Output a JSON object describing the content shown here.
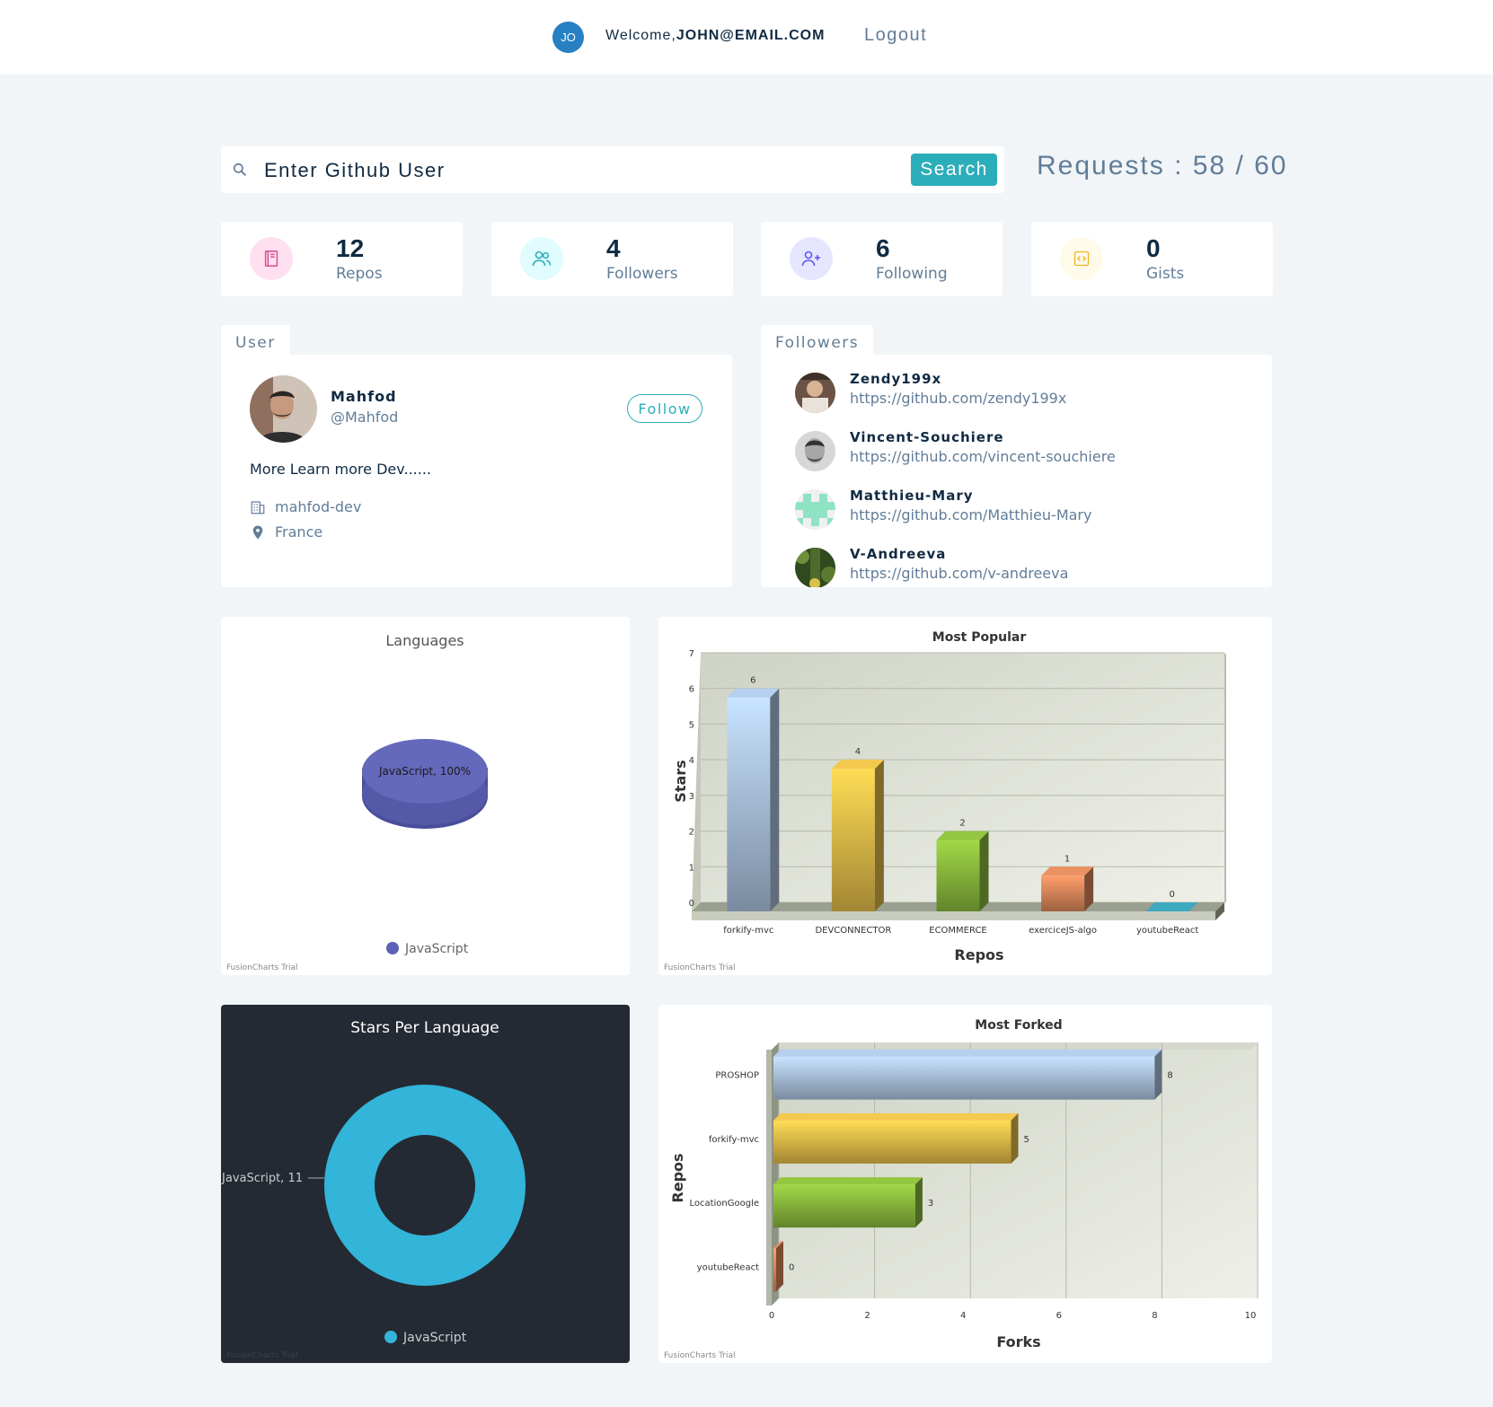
{
  "nav": {
    "avatar_initials": "JO",
    "welcome_prefix": "Welcome,",
    "welcome_user": "JOHN@EMAIL.COM",
    "logout_label": "Logout"
  },
  "search": {
    "placeholder": "Enter Github User",
    "button_label": "Search",
    "requests_text": "Requests : 58 / 60"
  },
  "stats": [
    {
      "value": "12",
      "label": "Repos",
      "icon": "book-icon",
      "color": "#da4a91"
    },
    {
      "value": "4",
      "label": "Followers",
      "icon": "users-icon",
      "color": "#2caeba"
    },
    {
      "value": "6",
      "label": "Following",
      "icon": "user-plus-icon",
      "color": "#5d55fa"
    },
    {
      "value": "0",
      "label": "Gists",
      "icon": "code-icon",
      "color": "#f0b429"
    }
  ],
  "user": {
    "tab_label": "User",
    "name": "Mahfod",
    "login": "@Mahfod",
    "follow_label": "Follow",
    "bio": "More Learn more Dev......",
    "company": "mahfod-dev",
    "location": "France"
  },
  "followers": {
    "tab_label": "Followers",
    "items": [
      {
        "name": "Zendy199x",
        "url": "https://github.com/zendy199x"
      },
      {
        "name": "Vincent-Souchiere",
        "url": "https://github.com/vincent-souchiere"
      },
      {
        "name": "Matthieu-Mary",
        "url": "https://github.com/Matthieu-Mary"
      },
      {
        "name": "V-Andreeva",
        "url": "https://github.com/v-andreeva"
      }
    ]
  },
  "chart_data": [
    {
      "type": "pie",
      "title": "Languages",
      "categories": [
        "JavaScript"
      ],
      "values": [
        100
      ],
      "slice_label": "JavaScript, 100%",
      "legend": [
        "JavaScript"
      ],
      "colors": [
        "#5d62b5"
      ],
      "watermark": "FusionCharts Trial"
    },
    {
      "type": "bar",
      "title": "Most Popular",
      "xlabel": "Repos",
      "ylabel": "Stars",
      "categories": [
        "forkify-mvc",
        "DEVCONNECTOR",
        "ECOMMERCE",
        "exerciceJS-algo",
        "youtubeReact"
      ],
      "values": [
        6,
        4,
        2,
        1,
        0
      ],
      "ylim": [
        0,
        7
      ],
      "yticks": [
        0,
        1,
        2,
        3,
        4,
        5,
        6,
        7
      ],
      "colors": [
        "#aec6e4",
        "#e8c04a",
        "#8cbd3e",
        "#e08a5d",
        "#3aa1b5"
      ],
      "watermark": "FusionCharts Trial"
    },
    {
      "type": "pie",
      "title": "Stars Per Language",
      "categories": [
        "JavaScript"
      ],
      "values": [
        11
      ],
      "slice_label": "JavaScript, 11",
      "legend": [
        "JavaScript"
      ],
      "colors": [
        "#33b4d9"
      ],
      "background": "#242a33",
      "watermark": "FusionCharts Trial"
    },
    {
      "type": "bar",
      "orientation": "horizontal",
      "title": "Most Forked",
      "xlabel": "Forks",
      "ylabel": "Repos",
      "categories": [
        "PROSHOP",
        "forkify-mvc",
        "LocationGoogle",
        "youtubeReact"
      ],
      "values": [
        8,
        5,
        3,
        0
      ],
      "xlim": [
        0,
        10
      ],
      "xticks": [
        0,
        2,
        4,
        6,
        8,
        10
      ],
      "colors": [
        "#aec6e4",
        "#e8c04a",
        "#8cbd3e",
        "#e08a5d"
      ],
      "watermark": "FusionCharts Trial"
    }
  ]
}
